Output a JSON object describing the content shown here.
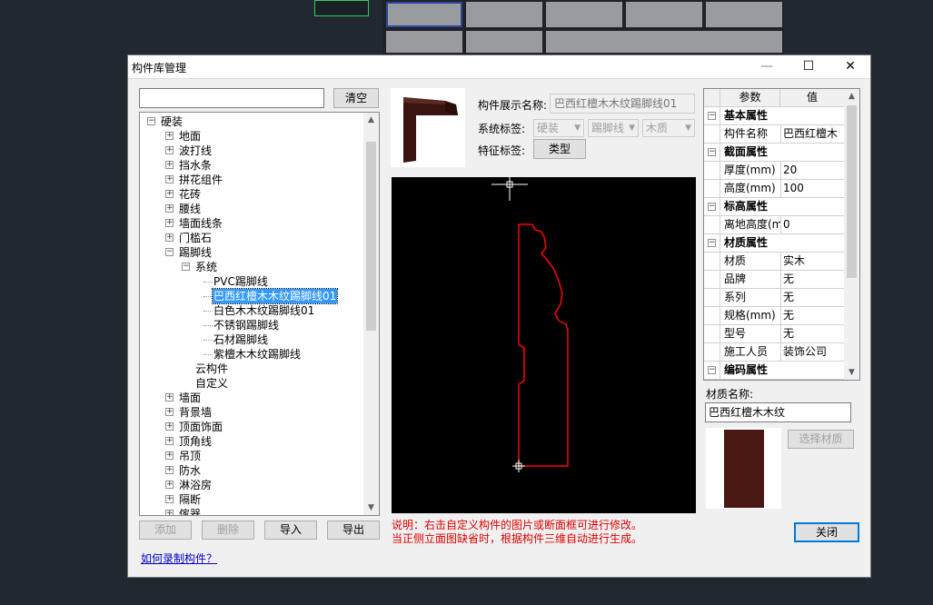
{
  "window": {
    "title": "构件库管理",
    "minimize": "—",
    "maximize": "☐",
    "close": "✕"
  },
  "search": {
    "value": "",
    "placeholder": "",
    "clear": "清空"
  },
  "tree": {
    "root": "硬装",
    "items": [
      "地面",
      "波打线",
      "挡水条",
      "拼花组件",
      "花砖",
      "腰线",
      "墙面线条",
      "门槛石",
      "踢脚线"
    ],
    "system": "系统",
    "system_items": [
      "PVC踢脚线",
      "巴西红檀木木纹踢脚线01",
      "白色木木纹踢脚线01",
      "不锈钢踢脚线",
      "石材踢脚线",
      "紫檀木木纹踢脚线"
    ],
    "selected_index": 1,
    "cloud": "云构件",
    "custom": "自定义",
    "items2": [
      "墙面",
      "背景墙",
      "顶面饰面",
      "顶角线",
      "吊顶",
      "防水",
      "淋浴房",
      "隔断",
      "傢器"
    ]
  },
  "bottom_buttons": {
    "add": "添加",
    "delete": "删除",
    "import": "导入",
    "export": "导出",
    "help_link": "如何录制构件？"
  },
  "info": {
    "name_label": "构件展示名称:",
    "name_value": "巴西红檀木木纹踢脚线01",
    "system_tag_label": "系统标签:",
    "tags": [
      "硬装",
      "踢脚线",
      "木质"
    ],
    "feature_tag_label": "特征标签:",
    "type_button": "类型"
  },
  "note": {
    "line1": "说明：右击自定义构件的图片或断面框可进行修改。",
    "line2": "当正侧立面图缺省时，根据构件三维自动进行生成。"
  },
  "props": {
    "header_param": "参数",
    "header_value": "值",
    "rows": [
      {
        "k": "基本属性",
        "v": "",
        "group": true
      },
      {
        "k": "构件名称",
        "v": "巴西红檀木",
        "group": false
      },
      {
        "k": "截面属性",
        "v": "",
        "group": true
      },
      {
        "k": "厚度(mm)",
        "v": "20",
        "group": false
      },
      {
        "k": "高度(mm)",
        "v": "100",
        "group": false
      },
      {
        "k": "标高属性",
        "v": "",
        "group": true
      },
      {
        "k": "离地高度(m",
        "v": "0",
        "group": false
      },
      {
        "k": "材质属性",
        "v": "",
        "group": true
      },
      {
        "k": "材质",
        "v": "实木",
        "group": false
      },
      {
        "k": "品牌",
        "v": "无",
        "group": false
      },
      {
        "k": "系列",
        "v": "无",
        "group": false
      },
      {
        "k": "规格(mm)",
        "v": "无",
        "group": false
      },
      {
        "k": "型号",
        "v": "无",
        "group": false
      },
      {
        "k": "施工人员",
        "v": "装饰公司",
        "group": false
      },
      {
        "k": "编码属性",
        "v": "",
        "group": true
      }
    ]
  },
  "material": {
    "label": "材质名称:",
    "value": "巴西红檀木木纹",
    "select_button": "选择材质"
  },
  "close_button": "关闭",
  "colors": {
    "canvas_bg": "#000000",
    "profile": "#ff0000",
    "note": "#e00000",
    "link": "#0000cc",
    "swatch": "#4a1812"
  }
}
